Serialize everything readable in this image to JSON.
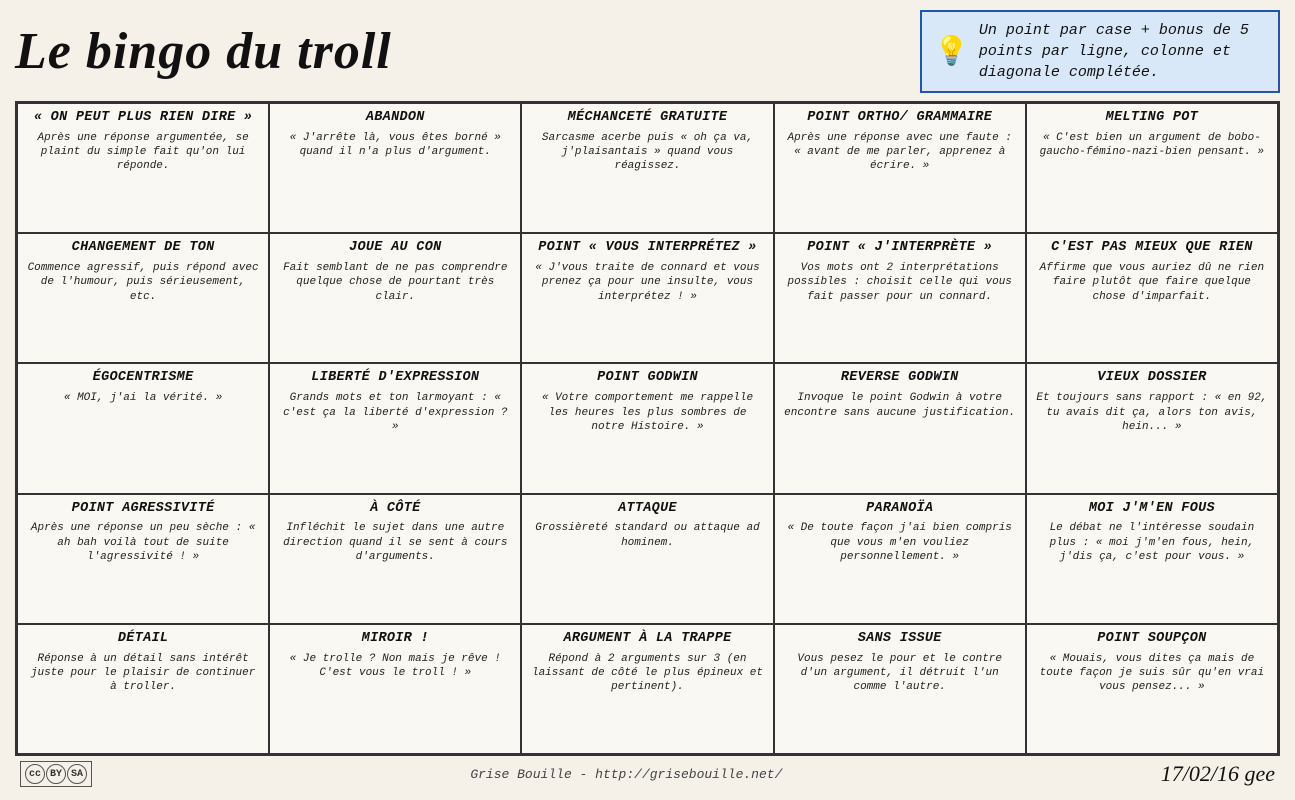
{
  "header": {
    "title": "Le bingo du troll",
    "rules": "Un point par case + bonus de 5 points par ligne, colonne et diagonale complétée."
  },
  "footer": {
    "credit": "Grise Bouille - http://grisebouille.net/",
    "signature": "17/02/16 gee"
  },
  "cells": [
    {
      "title": "« ON PEUT PLUS RIEN DIRE »",
      "desc": "Après une réponse argumentée, se plaint du simple fait qu'on lui réponde."
    },
    {
      "title": "ABANDON",
      "desc": "« J'arrête là, vous êtes borné » quand il n'a plus d'argument."
    },
    {
      "title": "MÉCHANCETÉ GRATUITE",
      "desc": "Sarcasme acerbe puis « oh ça va, j'plaisantais » quand vous réagissez."
    },
    {
      "title": "POINT ORTHO/ GRAMMAIRE",
      "desc": "Après une réponse avec une faute : « avant de me parler, apprenez à écrire. »"
    },
    {
      "title": "MELTING POT",
      "desc": "« C'est bien un argument de bobo-gaucho-fémino-nazi-bien pensant. »"
    },
    {
      "title": "CHANGEMENT DE TON",
      "desc": "Commence agressif, puis répond avec de l'humour, puis sérieusement, etc."
    },
    {
      "title": "JOUE AU CON",
      "desc": "Fait semblant de ne pas comprendre quelque chose de pourtant très clair."
    },
    {
      "title": "POINT « VOUS INTERPRÉTEZ »",
      "desc": "« J'vous traite de connard et vous prenez ça pour une insulte, vous interprétez ! »"
    },
    {
      "title": "POINT « J'INTERPRÈTE »",
      "desc": "Vos mots ont 2 interprétations possibles : choisit celle qui vous fait passer pour un connard."
    },
    {
      "title": "C'EST PAS MIEUX QUE RIEN",
      "desc": "Affirme que vous auriez dû ne rien faire plutôt que faire quelque chose d'imparfait."
    },
    {
      "title": "ÉGOCENTRISME",
      "desc": "« MOI, j'ai la vérité. »"
    },
    {
      "title": "LIBERTÉ D'EXPRESSION",
      "desc": "Grands mots et ton larmoyant : « c'est ça la liberté d'expression ? »"
    },
    {
      "title": "POINT GODWIN",
      "desc": "« Votre comportement me rappelle les heures les plus sombres de notre Histoire. »"
    },
    {
      "title": "REVERSE GODWIN",
      "desc": "Invoque le point Godwin à votre encontre sans aucune justification."
    },
    {
      "title": "VIEUX DOSSIER",
      "desc": "Et toujours sans rapport : « en 92, tu avais dit ça, alors ton avis, hein... »"
    },
    {
      "title": "POINT AGRESSIVITÉ",
      "desc": "Après une réponse un peu sèche : « ah bah voilà tout de suite l'agressivité ! »"
    },
    {
      "title": "À CÔTÉ",
      "desc": "Infléchit le sujet dans une autre direction quand il se sent à cours d'arguments."
    },
    {
      "title": "ATTAQUE",
      "desc": "Grossièreté standard ou attaque ad hominem."
    },
    {
      "title": "PARANOÏA",
      "desc": "« De toute façon j'ai bien compris que vous m'en vouliez personnellement. »"
    },
    {
      "title": "MOI J'M'EN FOUS",
      "desc": "Le débat ne l'intéresse soudain plus : « moi j'm'en fous, hein, j'dis ça, c'est pour vous. »"
    },
    {
      "title": "DÉTAIL",
      "desc": "Réponse à un détail sans intérêt juste pour le plaisir de continuer à troller."
    },
    {
      "title": "MIROIR !",
      "desc": "« Je trolle ? Non mais je rêve ! C'est vous le troll ! »"
    },
    {
      "title": "ARGUMENT À LA TRAPPE",
      "desc": "Répond à 2 arguments sur 3 (en laissant de côté le plus épineux et pertinent)."
    },
    {
      "title": "SANS ISSUE",
      "desc": "Vous pesez le pour et le contre d'un argument, il détruit l'un comme l'autre."
    },
    {
      "title": "POINT SOUPÇON",
      "desc": "« Mouais, vous dites ça mais de toute façon je suis sûr qu'en vrai vous pensez... »"
    }
  ]
}
